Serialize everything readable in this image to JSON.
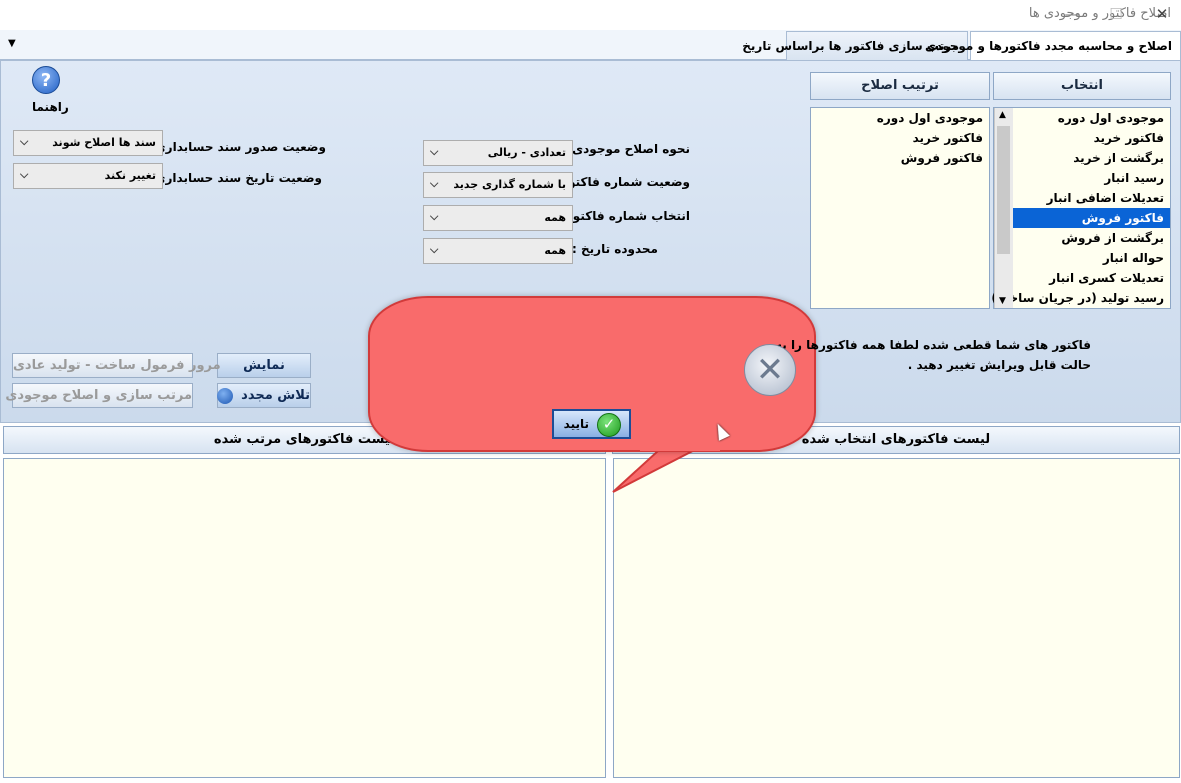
{
  "window": {
    "title": "اصلاح فاکتور و موجودی ها",
    "minimize": "—",
    "maximize": "☐",
    "close": "✕"
  },
  "tabs": [
    {
      "label": "اصلاح و محاسبه مجدد فاکتورها و موجودی",
      "active": true
    },
    {
      "label": "مرتب سازی فاکتور ها براساس تاریخ",
      "active": false
    }
  ],
  "tabstrip": {
    "menu_arrow": "▼"
  },
  "help": {
    "icon": "?",
    "label": "راهنما"
  },
  "selection": {
    "header": "انتخاب",
    "items": [
      "موجودی اول دوره",
      "فاکتور خرید",
      "برگشت از خرید",
      "رسید انبار",
      "تعدیلات اضافی انبار",
      "فاکتور فروش",
      "برگشت از فروش",
      "حواله انبار",
      "تعدیلات کسری انبار",
      "رسید تولید (در جریان ساخت)"
    ],
    "selected_index": 5,
    "scroll_up": "▲",
    "scroll_down": "▼"
  },
  "order": {
    "header": "ترتیب اصلاح",
    "items": [
      "موجودی اول دوره",
      "فاکتور خرید",
      "فاکتور فروش"
    ]
  },
  "form_right": [
    {
      "label": "نحوه اصلاح موجودی :",
      "value": "تعدادی - ریالی"
    },
    {
      "label": "وضعیت شماره فاکتور :",
      "value": "با شماره گذاری جدید"
    },
    {
      "label": "انتخاب شماره فاکتور :",
      "value": "همه"
    },
    {
      "label": "محدوده تاریخ :",
      "value": "همه"
    }
  ],
  "form_left": [
    {
      "label": "وضعیت صدور سند حسابداری :",
      "value": "سند ها اصلاح شوند"
    },
    {
      "label": "وضعیت تاریخ سند حسابداری :",
      "value": "تغییر نکند"
    }
  ],
  "combo_arrow": "⌵",
  "buttons": {
    "show": "نمایش",
    "retry": "تلاش مجدد",
    "review_formula": "مرور فرمول ساخت - تولید عادی",
    "sort_fix": "مرتب سازی و اصلاح موجودی"
  },
  "lists": {
    "selected_invoices": "لیست فاکتورهای انتخاب شده",
    "sorted_invoices": "لیست فاکتورهای مرتب شده"
  },
  "dialog": {
    "message": "فاکتور های شما قطعی شده لطفا همه فاکتورها را به حالت قابل ویرایش تغییر دهید .",
    "ok": "تایید",
    "x_glyph": "✕",
    "check_glyph": "✓"
  }
}
